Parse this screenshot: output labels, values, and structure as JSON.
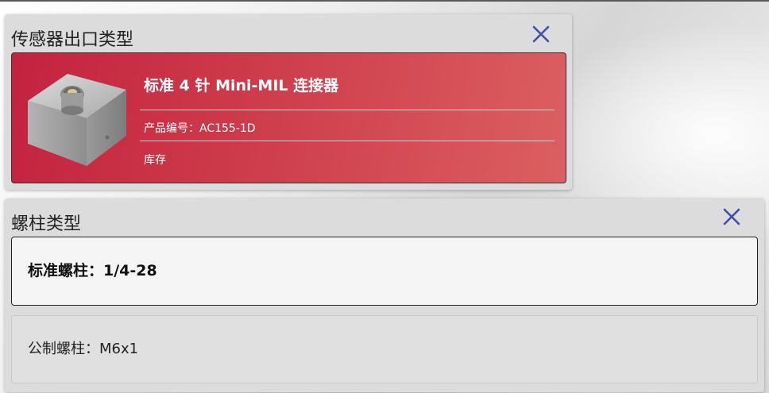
{
  "sensor_output": {
    "title": "传感器出口类型",
    "close_icon": "close-icon",
    "product": {
      "name": "标准 4 针 Mini-MIL 连接器",
      "part_number": "产品编号：AC155-1D",
      "stock": "库存",
      "card_color": "#c4223f"
    }
  },
  "stud_type": {
    "title": "螺柱类型",
    "close_icon": "close-icon",
    "options": [
      {
        "label": "标准螺柱：1/4-28",
        "selected": true
      },
      {
        "label": "公制螺柱：M6x1",
        "selected": false
      }
    ]
  },
  "colors": {
    "accent": "#3f4fa8",
    "selected_border": "#222222"
  }
}
